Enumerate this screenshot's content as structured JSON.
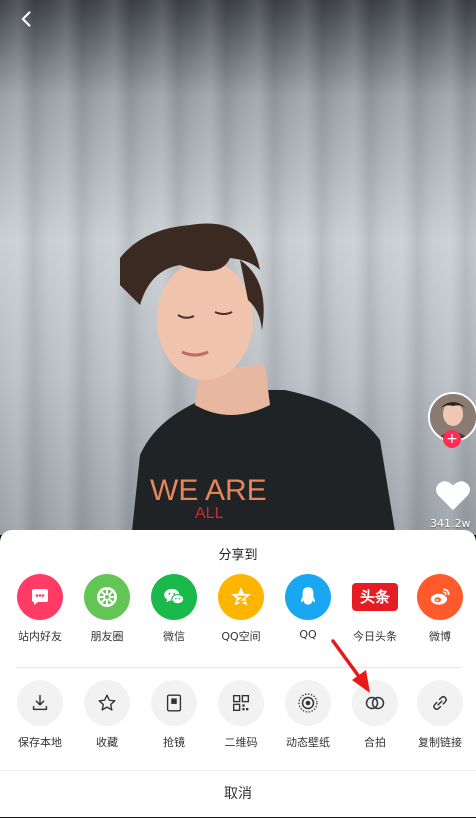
{
  "video": {
    "shirt_text": "WE ARE",
    "shirt_text2": "ALL"
  },
  "side": {
    "like_count": "341.2w"
  },
  "share": {
    "title": "分享到",
    "row1": [
      {
        "label": "站内好友",
        "icon": "chat-icon",
        "bg": "#ff3b66"
      },
      {
        "label": "朋友圈",
        "icon": "moments-icon",
        "bg": "#62c554"
      },
      {
        "label": "微信",
        "icon": "wechat-icon",
        "bg": "#19b94b"
      },
      {
        "label": "QQ空间",
        "icon": "qzone-star-icon",
        "bg": "#ffb400"
      },
      {
        "label": "QQ",
        "icon": "qq-penguin-icon",
        "bg": "#1aa7f2"
      },
      {
        "label": "今日头条",
        "icon": "toutiao-icon",
        "bg": "#e51c23"
      },
      {
        "label": "微博",
        "icon": "weibo-icon",
        "bg": "#ff5a2b"
      }
    ],
    "row2": [
      {
        "label": "保存本地",
        "icon": "download-icon"
      },
      {
        "label": "收藏",
        "icon": "star-outline-icon"
      },
      {
        "label": "抢镜",
        "icon": "frame-icon"
      },
      {
        "label": "二维码",
        "icon": "qr-code-icon"
      },
      {
        "label": "动态壁纸",
        "icon": "live-wallpaper-icon"
      },
      {
        "label": "合拍",
        "icon": "duet-icon"
      },
      {
        "label": "复制链接",
        "icon": "link-icon"
      }
    ],
    "toutiao_text": "头条",
    "cancel": "取消"
  },
  "colors": {
    "accent": "#ff2c55",
    "arrow": "#e81919"
  }
}
